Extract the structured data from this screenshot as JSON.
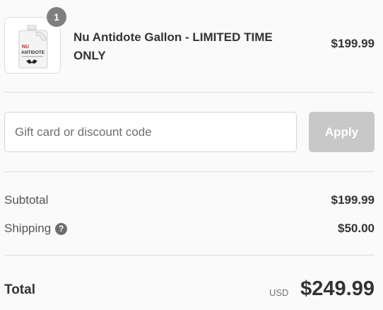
{
  "product": {
    "quantity": "1",
    "title": "Nu Antidote Gallon - LIMITED TIME ONLY",
    "price": "$199.99",
    "image_label_top": "NU",
    "image_label_bottom": "ANTIDOTE"
  },
  "discount": {
    "placeholder": "Gift card or discount code",
    "apply_label": "Apply"
  },
  "totals": {
    "subtotal_label": "Subtotal",
    "subtotal_value": "$199.99",
    "shipping_label": "Shipping",
    "shipping_help_icon": "question-circle-icon",
    "shipping_value": "$50.00",
    "total_label": "Total",
    "currency": "USD",
    "total_value": "$249.99"
  },
  "colors": {
    "badge": "#7f7f7f",
    "apply_disabled": "#c8c8c8",
    "accent_red": "#d12b2b"
  }
}
